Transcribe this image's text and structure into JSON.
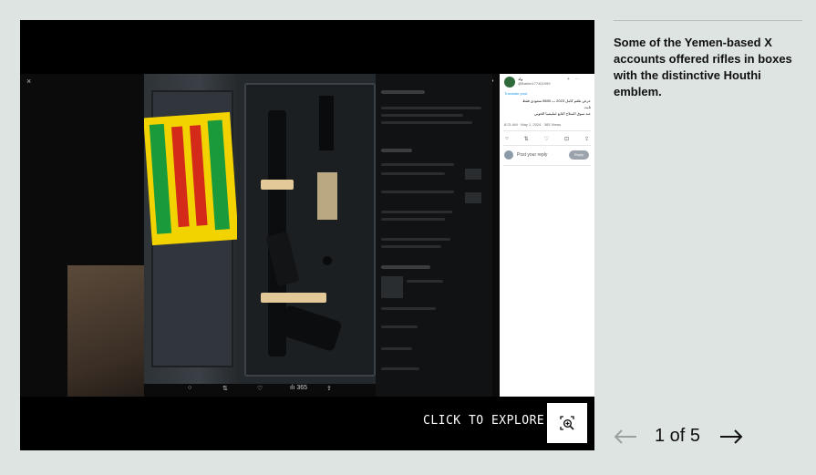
{
  "viewer": {
    "explore_label": "CLICK TO EXPLORE",
    "close_glyph": "×",
    "expand_glyph": "»",
    "photo_toolbar": [
      "○",
      "⇅",
      "♡",
      "ılı 365",
      "⇪"
    ],
    "tweet": {
      "name": "ولد",
      "handle": "@Bakhri177401999",
      "translate": "Translate post",
      "text_lines": [
        "عرض طقم كامل 2023 ب 8600 سعودي فقط",
        "ثابت",
        "عند سوق السلاح التابع لمليشيا الحوثي"
      ],
      "meta": "8:21 AM · May 1, 2024 · 365 Views",
      "actions": [
        "○",
        "⇅",
        "♡",
        "⊡",
        "⇪"
      ],
      "reply_placeholder": "Post your reply",
      "reply_button": "Reply"
    }
  },
  "caption": "Some of the Yemen-based X accounts offered rifles in boxes with the distinctive Houthi emblem.",
  "pager": {
    "current": 1,
    "total": 5,
    "label": "1 of 5"
  },
  "colors": {
    "background": "#dde4e2",
    "viewer": "#000000",
    "text": "#111111",
    "arrow_disabled": "#9aa19f"
  },
  "icons": {
    "explore": "zoom-in-icon",
    "prev": "arrow-left-icon",
    "next": "arrow-right-icon"
  }
}
